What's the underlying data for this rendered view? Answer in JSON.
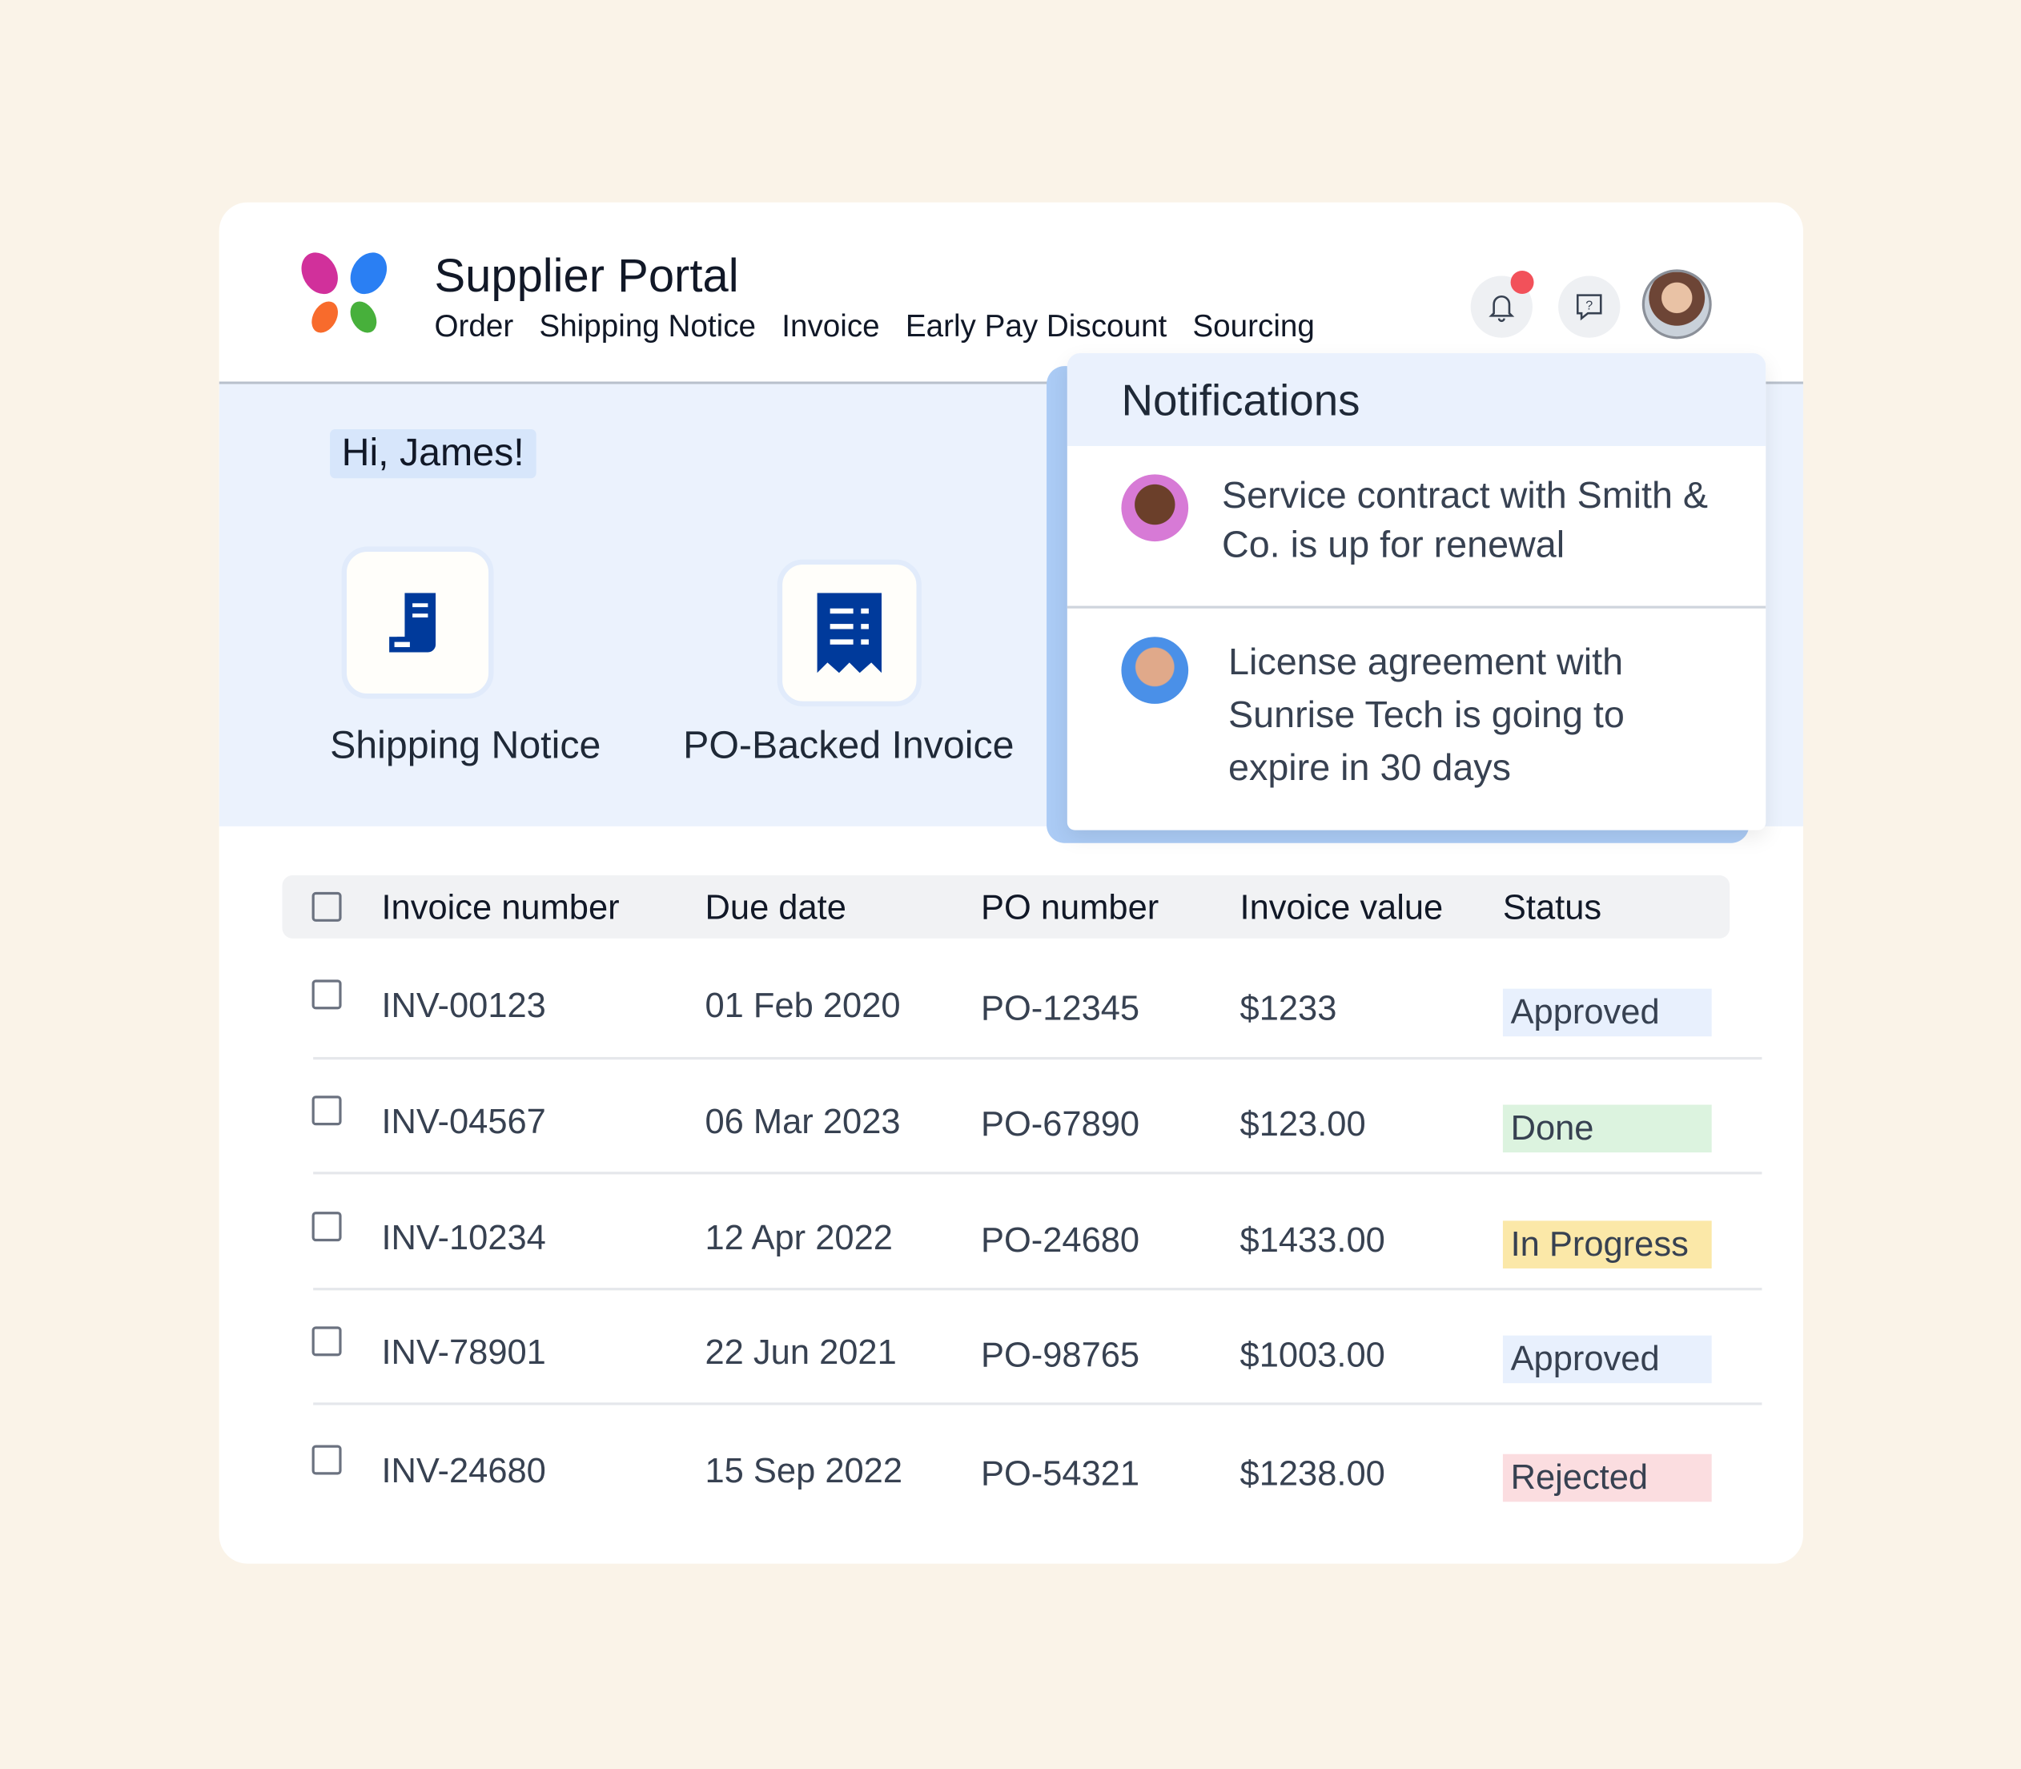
{
  "header": {
    "title": "Supplier Portal",
    "nav": [
      "Order",
      "Shipping Notice",
      "Invoice",
      "Early Pay Discount",
      "Sourcing"
    ],
    "icons": {
      "notifications": "bell-icon",
      "help": "help-chat-icon",
      "avatar": "user-avatar"
    },
    "notification_dot_color": "#f2515a"
  },
  "hero": {
    "greeting": "Hi, James!",
    "tiles": [
      {
        "label": "Shipping Notice",
        "icon": "shipping-receipt-icon"
      },
      {
        "label": "PO-Backed Invoice",
        "icon": "invoice-receipt-icon"
      }
    ],
    "icon_color": "#003a9b"
  },
  "notifications": {
    "title": "Notifications",
    "items": [
      {
        "text": "Service contract with Smith & Co. is up for renewal",
        "avatar_color": "#d77ad6"
      },
      {
        "text": "License agreement with Sunrise Tech is going to expire in 30 days",
        "avatar_color": "#4a90e8"
      }
    ]
  },
  "table": {
    "columns": [
      "Invoice number",
      "Due date",
      "PO number",
      "Invoice value",
      "Status"
    ],
    "rows": [
      {
        "invoice": "INV-00123",
        "due": "01 Feb 2020",
        "po": "PO-12345",
        "value": "$1233",
        "status": "Approved",
        "status_color": "#e8f0fd"
      },
      {
        "invoice": "INV-04567",
        "due": "06 Mar 2023",
        "po": "PO-67890",
        "value": "$123.00",
        "status": "Done",
        "status_color": "#dcf3df"
      },
      {
        "invoice": "INV-10234",
        "due": "12 Apr 2022",
        "po": "PO-24680",
        "value": "$1433.00",
        "status": "In Progress",
        "status_color": "#fbe8a8"
      },
      {
        "invoice": "INV-78901",
        "due": "22 Jun 2021",
        "po": "PO-98765",
        "value": "$1003.00",
        "status": "Approved",
        "status_color": "#e8f0fd"
      },
      {
        "invoice": "INV-24680",
        "due": "15 Sep 2022",
        "po": "PO-54321",
        "value": "$1238.00",
        "status": "Rejected",
        "status_color": "#fbdde0"
      }
    ]
  }
}
